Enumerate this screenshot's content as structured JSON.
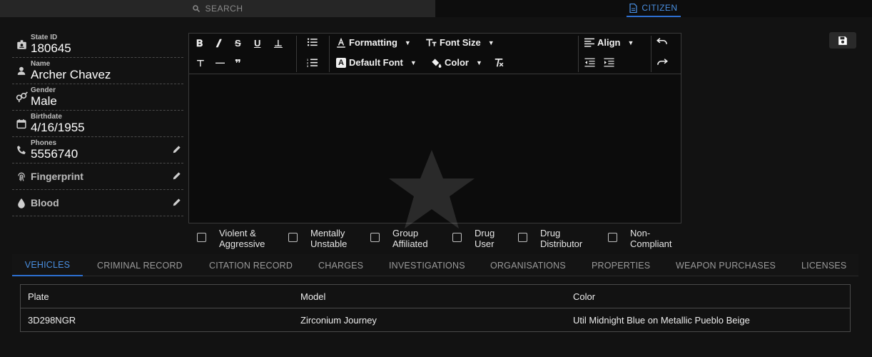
{
  "topbar": {
    "search_label": "SEARCH",
    "citizen_label": "CITIZEN"
  },
  "info": {
    "state_id": {
      "label": "State ID",
      "value": "180645"
    },
    "name": {
      "label": "Name",
      "value": "Archer Chavez"
    },
    "gender": {
      "label": "Gender",
      "value": "Male"
    },
    "birthdate": {
      "label": "Birthdate",
      "value": "4/16/1955"
    },
    "phones": {
      "label": "Phones",
      "value": "5556740"
    },
    "fingerprint": {
      "label": "Fingerprint"
    },
    "blood": {
      "label": "Blood"
    }
  },
  "editor": {
    "formatting_label": "Formatting",
    "font_size_label": "Font Size",
    "default_font_label": "Default Font",
    "color_label": "Color",
    "align_label": "Align"
  },
  "flags": [
    {
      "label": "Violent &\nAggressive"
    },
    {
      "label": "Mentally\nUnstable"
    },
    {
      "label": "Group\nAffiliated"
    },
    {
      "label": "Drug\nUser"
    },
    {
      "label": "Drug\nDistributor"
    },
    {
      "label": "Non-\nCompliant"
    }
  ],
  "subtabs": [
    {
      "label": "VEHICLES"
    },
    {
      "label": "CRIMINAL RECORD"
    },
    {
      "label": "CITATION RECORD"
    },
    {
      "label": "CHARGES"
    },
    {
      "label": "INVESTIGATIONS"
    },
    {
      "label": "ORGANISATIONS"
    },
    {
      "label": "PROPERTIES"
    },
    {
      "label": "WEAPON PURCHASES"
    },
    {
      "label": "LICENSES"
    }
  ],
  "table": {
    "columns": [
      "Plate",
      "Model",
      "Color"
    ],
    "rows": [
      [
        "3D298NGR",
        "Zirconium Journey",
        "Util Midnight Blue on Metallic Pueblo Beige"
      ]
    ]
  },
  "colors": {
    "accent": "#4a90e2",
    "background": "#121212"
  }
}
